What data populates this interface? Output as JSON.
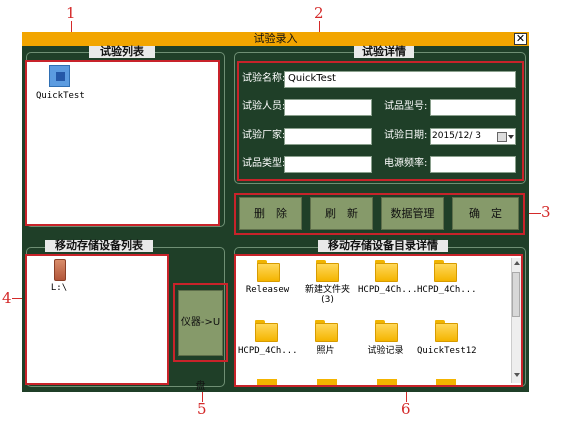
{
  "callouts": [
    "1",
    "2",
    "3",
    "4",
    "5",
    "6"
  ],
  "window": {
    "title": "试验录入",
    "close_glyph": "✕"
  },
  "sections": {
    "test_list": "试验列表",
    "test_details": "试验详情",
    "device_list": "移动存储设备列表",
    "device_dir": "移动存储设备目录详情"
  },
  "test_list_items": [
    {
      "label": "QuickTest",
      "icon": "blue-file-icon"
    }
  ],
  "form": {
    "test_name_label": "试验名称:",
    "test_name_value": "QuickTest",
    "tester_label": "试验人员:",
    "tester_value": "",
    "sample_model_label": "试品型号:",
    "sample_model_value": "",
    "manufacturer_label": "试验厂家:",
    "manufacturer_value": "",
    "date_label": "试验日期:",
    "date_value": "2015/12/ 3",
    "sample_type_label": "试品类型:",
    "sample_type_value": "",
    "power_freq_label": "电源频率:",
    "power_freq_value": ""
  },
  "buttons": {
    "delete": "删　除",
    "refresh": "刷　新",
    "data_manage": "数据管理",
    "confirm": "确　定",
    "to_usb": "仪器->U盘"
  },
  "devices": [
    {
      "label": "L:\\",
      "icon": "usb-drive-icon"
    }
  ],
  "directory_items": [
    {
      "label": "Releasew"
    },
    {
      "label": "新建文件夹\n(3)"
    },
    {
      "label": "HCPD_4Ch..."
    },
    {
      "label": "HCPD_4Ch..."
    },
    {
      "label": "HCPD_4Ch..."
    },
    {
      "label": "照片"
    },
    {
      "label": "试验记录"
    },
    {
      "label": "QuickTest12"
    }
  ],
  "colors": {
    "accent": "#f2a500",
    "window_bg": "#1f3f28",
    "annotation": "#d42a2a",
    "button": "#869a6a"
  }
}
